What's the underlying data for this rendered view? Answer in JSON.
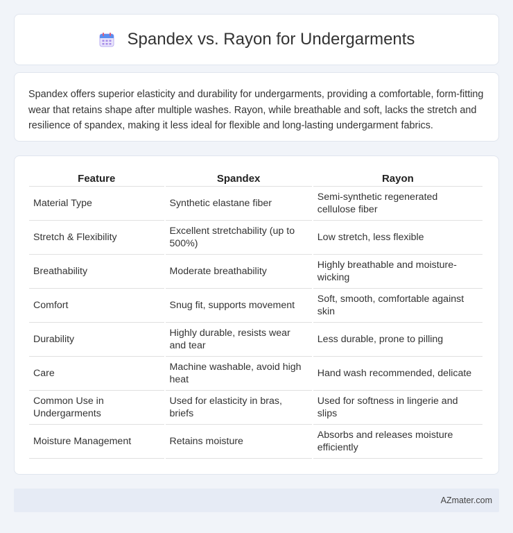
{
  "header": {
    "icon": "calendar-icon",
    "title": "Spandex vs. Rayon for Undergarments"
  },
  "intro": {
    "text": "Spandex offers superior elasticity and durability for undergarments, providing a comfortable, form-fitting wear that retains shape after multiple washes. Rayon, while breathable and soft, lacks the stretch and resilience of spandex, making it less ideal for flexible and long-lasting undergarment fabrics."
  },
  "table": {
    "headers": [
      "Feature",
      "Spandex",
      "Rayon"
    ],
    "rows": [
      [
        "Material Type",
        "Synthetic elastane fiber",
        "Semi-synthetic regenerated cellulose fiber"
      ],
      [
        "Stretch & Flexibility",
        "Excellent stretchability (up to 500%)",
        "Low stretch, less flexible"
      ],
      [
        "Breathability",
        "Moderate breathability",
        "Highly breathable and moisture-wicking"
      ],
      [
        "Comfort",
        "Snug fit, supports movement",
        "Soft, smooth, comfortable against skin"
      ],
      [
        "Durability",
        "Highly durable, resists wear and tear",
        "Less durable, prone to pilling"
      ],
      [
        "Care",
        "Machine washable, avoid high heat",
        "Hand wash recommended, delicate"
      ],
      [
        "Common Use in Undergarments",
        "Used for elasticity in bras, briefs",
        "Used for softness in lingerie and slips"
      ],
      [
        "Moisture Management",
        "Retains moisture",
        "Absorbs and releases moisture efficiently"
      ]
    ]
  },
  "footer": {
    "site": "AZmater.com"
  },
  "colors": {
    "background": "#f1f4f9",
    "card": "#ffffff",
    "footer_bg": "#e6ebf5"
  }
}
